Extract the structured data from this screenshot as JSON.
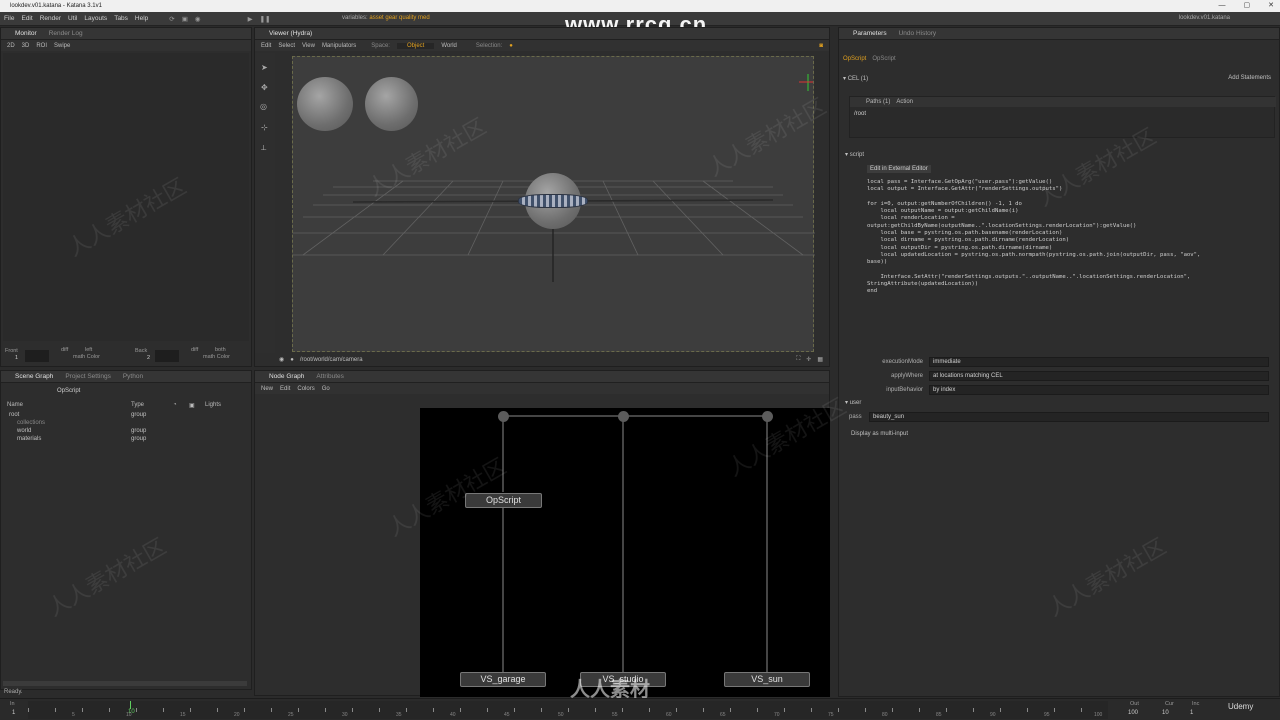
{
  "window": {
    "title": "lookdev.v01.katana - Katana 3.1v1",
    "controls": [
      "—",
      "▢",
      "✕"
    ]
  },
  "menu": {
    "items": [
      "File",
      "Edit",
      "Render",
      "Util",
      "Layouts",
      "Tabs",
      "Help"
    ],
    "variables_label": "variables:",
    "variables_value": "asset gear quality med",
    "file_label": "lookdev.v01.katana"
  },
  "watermark": {
    "url": "www.rrcg.cn",
    "cn": "人人素材社区",
    "footer_cn": "人人素材",
    "udemy": "Udemy"
  },
  "monitor": {
    "tabs": [
      "Monitor",
      "Render Log"
    ],
    "toolbar": [
      "2D",
      "3D",
      "ROI",
      "Swipe"
    ],
    "front_label": "Front",
    "front_value": "1",
    "back_label": "Back",
    "back_value": "2",
    "diff_label": "diff",
    "math_label": "math Color",
    "left_label": "left",
    "both_label": "both"
  },
  "viewer": {
    "tab": "Viewer (Hydra)",
    "menus": [
      "Edit",
      "Select",
      "View",
      "Manipulators"
    ],
    "space_label": "Space:",
    "object_label": "Object",
    "world_label": "World",
    "selection_label": "Selection:",
    "camera_path": "/root/world/cam/camera"
  },
  "scene_graph": {
    "tabs": [
      "Scene Graph",
      "Project Settings",
      "Python"
    ],
    "node_label": "OpScript",
    "columns": [
      "Name",
      "Type",
      "",
      "",
      "Lights"
    ],
    "rows": [
      {
        "name": "root",
        "type": "group",
        "indent": 0
      },
      {
        "name": "collections",
        "type": "",
        "indent": 1
      },
      {
        "name": "world",
        "type": "group",
        "indent": 1
      },
      {
        "name": "materials",
        "type": "group",
        "indent": 1
      }
    ],
    "status": "Ready."
  },
  "node_graph": {
    "tabs": [
      "Node Graph",
      "Attributes"
    ],
    "menus": [
      "New",
      "Edit",
      "Colors",
      "Go"
    ],
    "opscript_label": "OpScript",
    "bottom_nodes": [
      "VS_garage",
      "VS_studio",
      "VS_sun"
    ]
  },
  "parameters": {
    "tabs": [
      "Parameters",
      "Undo History"
    ],
    "node_name": "OpScript",
    "node_type": "OpScript",
    "cel_label": "CEL (1)",
    "add_statements": "Add Statements",
    "paths_label": "Paths (1)",
    "action_label": "Action",
    "path_value": "/root",
    "script_label": "script",
    "edit_external": "Edit in External Editor",
    "code": "local pass = Interface.GetOpArg(\"user.pass\"):getValue()\nlocal output = Interface.GetAttr(\"renderSettings.outputs\")\n\nfor i=0, output:getNumberOfChildren() -1, 1 do\n    local outputName = output:getChildName(i)\n    local renderLocation =\noutput:getChildByName(outputName..\".locationSettings.renderLocation\"):getValue()\n    local base = pystring.os.path.basename(renderLocation)\n    local dirname = pystring.os.path.dirname(renderLocation)\n    local outputDir = pystring.os.path.dirname(dirname)\n    local updatedLocation = pystring.os.path.normpath(pystring.os.path.join(outputDir, pass, \"aov\",\nbase))\n\n    Interface.SetAttr(\"renderSettings.outputs.\"..outputName..\".locationSettings.renderLocation\",\nStringAttribute(updatedLocation))\nend",
    "execution_mode_label": "executionMode",
    "execution_mode_value": "immediate",
    "apply_where_label": "applyWhere",
    "apply_where_value": "at locations matching CEL",
    "input_behavior_label": "inputBehavior",
    "input_behavior_value": "by index",
    "user_label": "user",
    "pass_label": "pass",
    "pass_value": "beauty_sun",
    "display_multi": "Display as multi-input"
  },
  "timeline": {
    "in_label": "In",
    "in_value": "1",
    "current": "10",
    "out_label": "Out",
    "out_value": "100",
    "cur_label": "Cur",
    "cur_value": "10",
    "inc_label": "Inc",
    "inc_value": "1",
    "ticks": [
      "5",
      "10",
      "15",
      "20",
      "25",
      "30",
      "35",
      "40",
      "45",
      "50",
      "55",
      "60",
      "65",
      "70",
      "75",
      "80",
      "85",
      "90",
      "95",
      "100"
    ]
  }
}
